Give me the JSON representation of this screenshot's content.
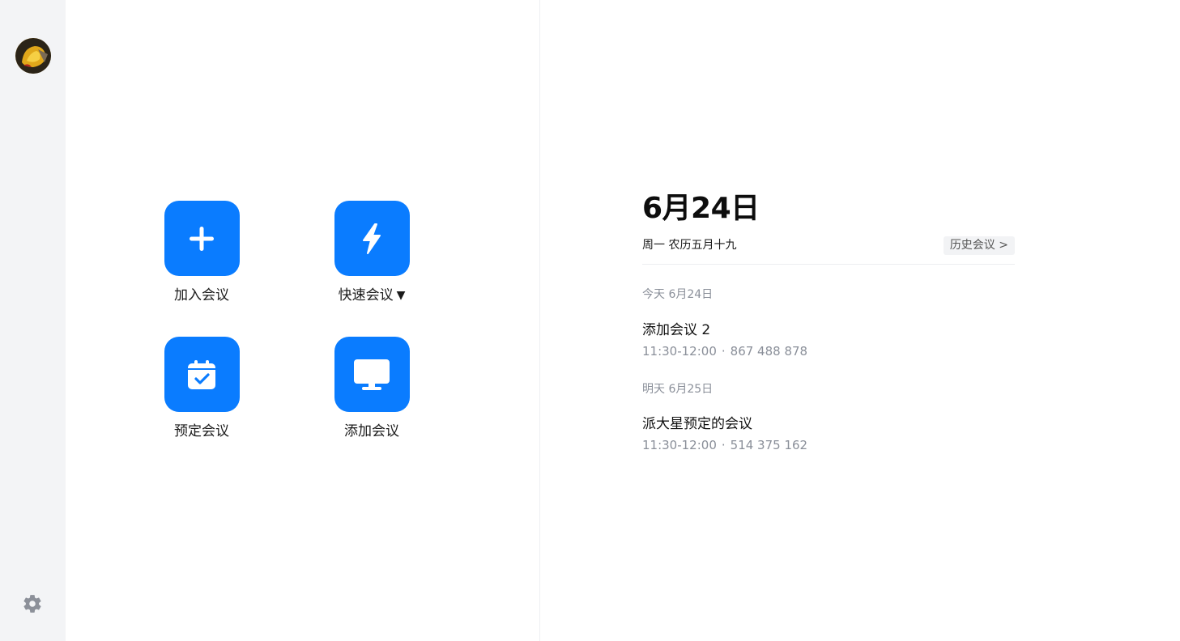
{
  "sidebar": {
    "avatar_icon": "user-avatar",
    "settings_icon": "gear-icon"
  },
  "actions": [
    {
      "label": "加入会议",
      "icon": "plus-icon",
      "has_dropdown": false
    },
    {
      "label": "快速会议",
      "icon": "lightning-icon",
      "has_dropdown": true,
      "dropdown_glyph": "▼"
    },
    {
      "label": "预定会议",
      "icon": "calendar-check-icon",
      "has_dropdown": false
    },
    {
      "label": "添加会议",
      "icon": "monitor-icon",
      "has_dropdown": false
    }
  ],
  "header": {
    "date": "6月24日",
    "subtitle": "周一 农历五月十九",
    "history_button": "历史会议 >"
  },
  "schedule": {
    "today_label": "今天 6月24日",
    "tomorrow_label": "明天 6月25日",
    "meetings": [
      {
        "title": "添加会议 2",
        "time": "11:30-12:00",
        "separator": "·",
        "number": "867 488 878"
      },
      {
        "title": "派大星预定的会议",
        "time": "11:30-12:00",
        "separator": "·",
        "number": "514 375 162"
      }
    ]
  },
  "colors": {
    "accent": "#0a7cff",
    "sidebar_bg": "#f3f4f6",
    "muted_text": "#8a8f99"
  }
}
